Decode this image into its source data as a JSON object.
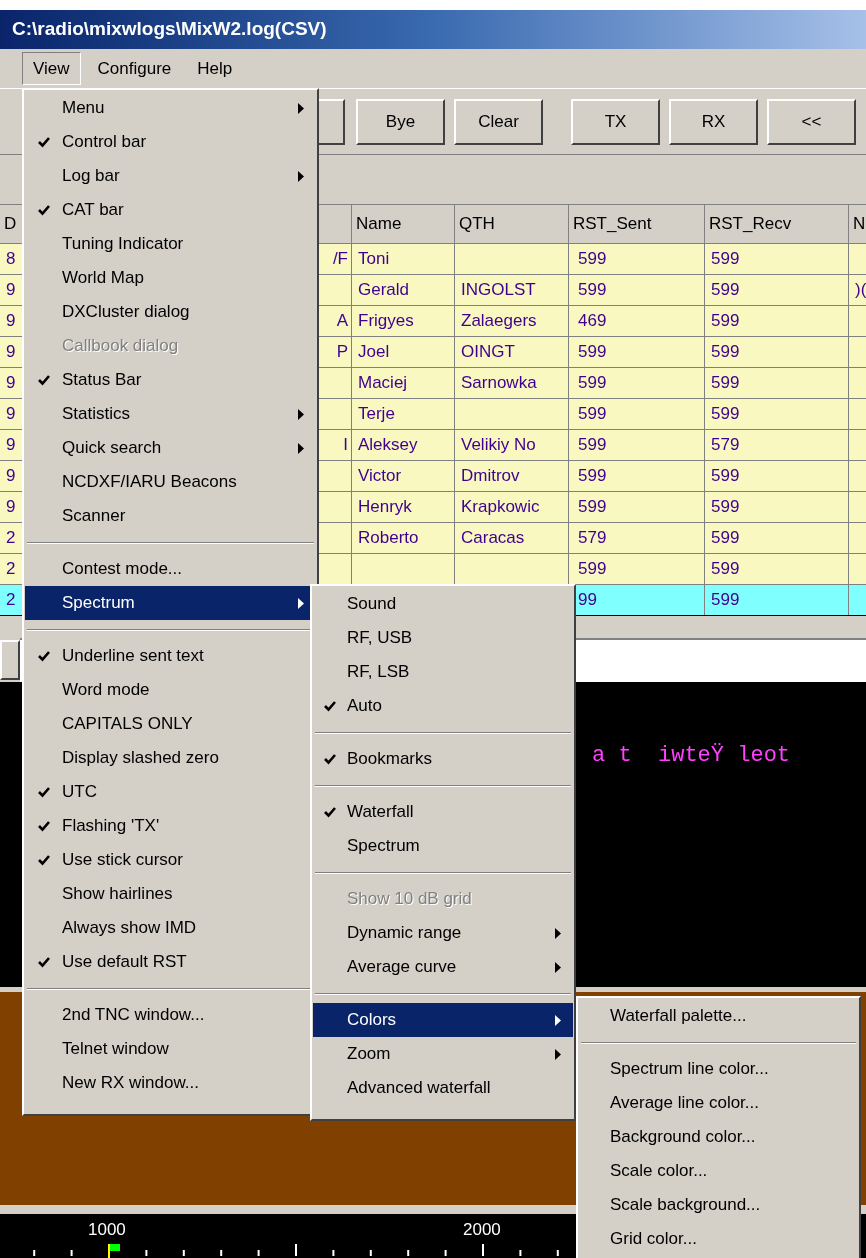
{
  "window": {
    "title": "C:\\radio\\mixwlogs\\MixW2.log(CSV)"
  },
  "menu_bar": [
    {
      "label": "View",
      "selected": true
    },
    {
      "label": "Configure",
      "selected": false
    },
    {
      "label": "Help",
      "selected": false
    }
  ],
  "toolbar": {
    "groups": [
      [
        "Bye",
        "Clear"
      ],
      [
        "TX",
        "RX",
        "<<"
      ]
    ]
  },
  "log_table": {
    "columns": [
      "D",
      "Name",
      "QTH",
      "RST_Sent",
      "RST_Recv",
      "N"
    ],
    "rows": [
      {
        "column_1": "8",
        "column_2": "/F",
        "name": "Toni",
        "rst_sent": "599",
        "rst_recv": "599",
        "selected": false
      },
      {
        "column_1": "9",
        "name": "Gerald",
        "qth": "INGOLST",
        "rst_sent": "599",
        "rst_recv": "599",
        "column_7": ")(",
        "selected": false
      },
      {
        "column_1": "9",
        "column_2": "A",
        "name": "Frigyes",
        "qth": "Zalaegers",
        "rst_sent": "469",
        "rst_recv": "599",
        "selected": false
      },
      {
        "column_1": "9",
        "column_2": "P",
        "name": "Joel",
        "qth": "OINGT",
        "rst_sent": "599",
        "rst_recv": "599",
        "selected": false
      },
      {
        "column_1": "9",
        "name": "Maciej",
        "qth": "Sarnowka",
        "rst_sent": "599",
        "rst_recv": "599",
        "selected": false
      },
      {
        "column_1": "9",
        "name": "Terje",
        "rst_sent": "599",
        "rst_recv": "599",
        "selected": false
      },
      {
        "column_1": "9",
        "column_2": "I",
        "name": "Aleksey",
        "qth": "Velikiy No",
        "rst_sent": "599",
        "rst_recv": "579",
        "selected": false
      },
      {
        "column_1": "9",
        "name": "Victor",
        "qth": "Dmitrov",
        "rst_sent": "599",
        "rst_recv": "599",
        "selected": false
      },
      {
        "column_1": "9",
        "name": "Henryk",
        "qth": "Krapkowic",
        "rst_sent": "599",
        "rst_recv": "599",
        "selected": false
      },
      {
        "column_1": "2",
        "name": "Roberto",
        "qth": "Caracas",
        "rst_sent": "579",
        "rst_recv": "599",
        "selected": false
      },
      {
        "column_1": "2",
        "rst_sent": "599",
        "rst_recv": "599",
        "selected": false
      },
      {
        "column_1": "2",
        "rst_sent": "99",
        "rst_recv": "599",
        "selected": true
      }
    ]
  },
  "receive_text": "a t  iwteŸ leot",
  "ruler": {
    "labels": [
      "1000",
      "2000"
    ]
  },
  "view_menu": [
    {
      "kind": "item",
      "label": "Menu",
      "checked": false,
      "submenu": true,
      "disabled": false,
      "selected": false
    },
    {
      "kind": "item",
      "label": "Control bar",
      "checked": true,
      "submenu": false,
      "disabled": false,
      "selected": false
    },
    {
      "kind": "item",
      "label": "Log bar",
      "checked": false,
      "submenu": true,
      "disabled": false,
      "selected": false
    },
    {
      "kind": "item",
      "label": "CAT bar",
      "checked": true,
      "submenu": false,
      "disabled": false,
      "selected": false
    },
    {
      "kind": "item",
      "label": "Tuning Indicator",
      "checked": false,
      "submenu": false,
      "disabled": false,
      "selected": false
    },
    {
      "kind": "item",
      "label": "World Map",
      "checked": false,
      "submenu": false,
      "disabled": false,
      "selected": false
    },
    {
      "kind": "item",
      "label": "DXCluster dialog",
      "checked": false,
      "submenu": false,
      "disabled": false,
      "selected": false
    },
    {
      "kind": "item",
      "label": "Callbook dialog",
      "checked": false,
      "submenu": false,
      "disabled": true,
      "selected": false
    },
    {
      "kind": "item",
      "label": "Status Bar",
      "checked": true,
      "submenu": false,
      "disabled": false,
      "selected": false
    },
    {
      "kind": "item",
      "label": "Statistics",
      "checked": false,
      "submenu": true,
      "disabled": false,
      "selected": false
    },
    {
      "kind": "item",
      "label": "Quick search",
      "checked": false,
      "submenu": true,
      "disabled": false,
      "selected": false
    },
    {
      "kind": "item",
      "label": "NCDXF/IARU Beacons",
      "checked": false,
      "submenu": false,
      "disabled": false,
      "selected": false
    },
    {
      "kind": "item",
      "label": "Scanner",
      "checked": false,
      "submenu": false,
      "disabled": false,
      "selected": false
    },
    {
      "kind": "separator"
    },
    {
      "kind": "item",
      "label": "Contest mode...",
      "checked": false,
      "submenu": false,
      "disabled": false,
      "selected": false
    },
    {
      "kind": "item",
      "label": "Spectrum",
      "checked": false,
      "submenu": true,
      "disabled": false,
      "selected": true
    },
    {
      "kind": "separator"
    },
    {
      "kind": "item",
      "label": "Underline sent text",
      "checked": true,
      "submenu": false,
      "disabled": false,
      "selected": false
    },
    {
      "kind": "item",
      "label": "Word mode",
      "checked": false,
      "submenu": false,
      "disabled": false,
      "selected": false
    },
    {
      "kind": "item",
      "label": "CAPITALS ONLY",
      "checked": false,
      "submenu": false,
      "disabled": false,
      "selected": false
    },
    {
      "kind": "item",
      "label": "Display slashed zero",
      "checked": false,
      "submenu": false,
      "disabled": false,
      "selected": false
    },
    {
      "kind": "item",
      "label": "UTC",
      "checked": true,
      "submenu": false,
      "disabled": false,
      "selected": false
    },
    {
      "kind": "item",
      "label": "Flashing 'TX'",
      "checked": true,
      "submenu": false,
      "disabled": false,
      "selected": false
    },
    {
      "kind": "item",
      "label": "Use stick cursor",
      "checked": true,
      "submenu": false,
      "disabled": false,
      "selected": false
    },
    {
      "kind": "item",
      "label": "Show hairlines",
      "checked": false,
      "submenu": false,
      "disabled": false,
      "selected": false
    },
    {
      "kind": "item",
      "label": "Always show IMD",
      "checked": false,
      "submenu": false,
      "disabled": false,
      "selected": false
    },
    {
      "kind": "item",
      "label": "Use default RST",
      "checked": true,
      "submenu": false,
      "disabled": false,
      "selected": false
    },
    {
      "kind": "separator"
    },
    {
      "kind": "item",
      "label": "2nd TNC window...",
      "checked": false,
      "submenu": false,
      "disabled": false,
      "selected": false
    },
    {
      "kind": "item",
      "label": "Telnet window",
      "checked": false,
      "submenu": false,
      "disabled": false,
      "selected": false
    },
    {
      "kind": "item",
      "label": "New RX window...",
      "checked": false,
      "submenu": false,
      "disabled": false,
      "selected": false
    }
  ],
  "spectrum_menu": [
    {
      "kind": "item",
      "label": "Sound",
      "checked": false,
      "submenu": false,
      "disabled": false,
      "selected": false
    },
    {
      "kind": "item",
      "label": "RF, USB",
      "checked": false,
      "submenu": false,
      "disabled": false,
      "selected": false
    },
    {
      "kind": "item",
      "label": "RF, LSB",
      "checked": false,
      "submenu": false,
      "disabled": false,
      "selected": false
    },
    {
      "kind": "item",
      "label": "Auto",
      "checked": true,
      "submenu": false,
      "disabled": false,
      "selected": false
    },
    {
      "kind": "separator"
    },
    {
      "kind": "item",
      "label": "Bookmarks",
      "checked": true,
      "submenu": false,
      "disabled": false,
      "selected": false
    },
    {
      "kind": "separator"
    },
    {
      "kind": "item",
      "label": "Waterfall",
      "checked": true,
      "submenu": false,
      "disabled": false,
      "selected": false
    },
    {
      "kind": "item",
      "label": "Spectrum",
      "checked": false,
      "submenu": false,
      "disabled": false,
      "selected": false
    },
    {
      "kind": "separator"
    },
    {
      "kind": "item",
      "label": "Show 10 dB grid",
      "checked": false,
      "submenu": false,
      "disabled": true,
      "selected": false
    },
    {
      "kind": "item",
      "label": "Dynamic range",
      "checked": false,
      "submenu": true,
      "disabled": false,
      "selected": false
    },
    {
      "kind": "item",
      "label": "Average curve",
      "checked": false,
      "submenu": true,
      "disabled": false,
      "selected": false
    },
    {
      "kind": "separator"
    },
    {
      "kind": "item",
      "label": "Colors",
      "checked": false,
      "submenu": true,
      "disabled": false,
      "selected": true
    },
    {
      "kind": "item",
      "label": "Zoom",
      "checked": false,
      "submenu": true,
      "disabled": false,
      "selected": false
    },
    {
      "kind": "item",
      "label": "Advanced waterfall",
      "checked": false,
      "submenu": false,
      "disabled": false,
      "selected": false
    }
  ],
  "colors_menu": [
    {
      "kind": "item",
      "label": "Waterfall palette...",
      "checked": false,
      "submenu": false,
      "disabled": false,
      "selected": false
    },
    {
      "kind": "separator"
    },
    {
      "kind": "item",
      "label": "Spectrum line color...",
      "checked": false,
      "submenu": false,
      "disabled": false,
      "selected": false
    },
    {
      "kind": "item",
      "label": "Average line color...",
      "checked": false,
      "submenu": false,
      "disabled": false,
      "selected": false
    },
    {
      "kind": "item",
      "label": "Background color...",
      "checked": false,
      "submenu": false,
      "disabled": false,
      "selected": false
    },
    {
      "kind": "item",
      "label": "Scale color...",
      "checked": false,
      "submenu": false,
      "disabled": false,
      "selected": false
    },
    {
      "kind": "item",
      "label": "Scale background...",
      "checked": false,
      "submenu": false,
      "disabled": false,
      "selected": false
    },
    {
      "kind": "item",
      "label": "Grid color...",
      "checked": false,
      "submenu": false,
      "disabled": false,
      "selected": false
    }
  ]
}
